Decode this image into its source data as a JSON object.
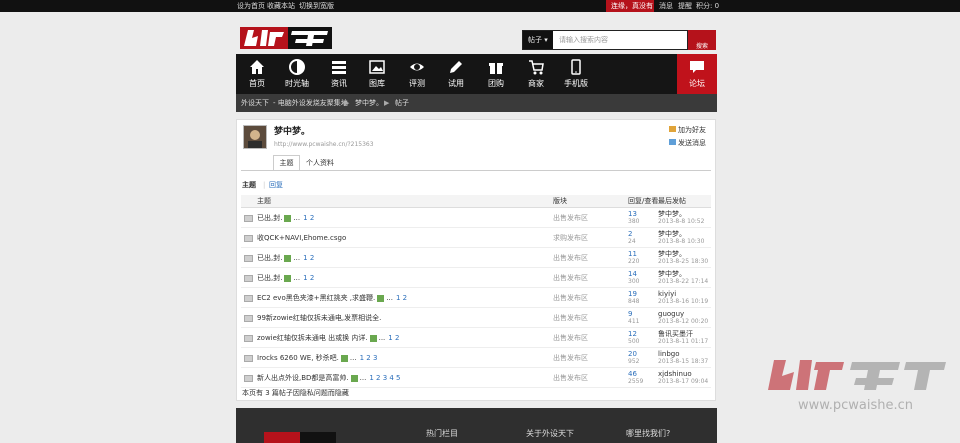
{
  "topbar": {
    "set_home": "设为首页",
    "bookmark": "收藏本站",
    "switch": "切换到宽版",
    "login_prompt": "连缘，真没有",
    "messages": "消息",
    "remind": "提醒",
    "points": "积分: 0"
  },
  "logo": {
    "text": "外设天下"
  },
  "search": {
    "type": "帖子",
    "placeholder": "请输入搜索内容",
    "button": "搜索"
  },
  "nav": {
    "items": [
      {
        "label": "首页",
        "icon": "home-icon"
      },
      {
        "label": "时光轴",
        "icon": "timeline-icon"
      },
      {
        "label": "资讯",
        "icon": "news-icon"
      },
      {
        "label": "图库",
        "icon": "gallery-icon"
      },
      {
        "label": "评测",
        "icon": "eye-icon"
      },
      {
        "label": "试用",
        "icon": "pen-icon"
      },
      {
        "label": "团购",
        "icon": "gift-icon"
      },
      {
        "label": "商家",
        "icon": "cart-icon"
      },
      {
        "label": "手机版",
        "icon": "phone-icon"
      }
    ],
    "forum": "论坛"
  },
  "breadcrumb": {
    "home": "外设天下",
    "board": "- 电脑外设发烧友聚集地",
    "user": "梦中梦。",
    "section": "帖子"
  },
  "profile": {
    "name": "梦中梦。",
    "url": "http://www.pcwaishe.cn/?215363",
    "add_friend": "加为好友",
    "send_message": "发送消息",
    "tabs": [
      "主题",
      "个人资料"
    ]
  },
  "subtabs": {
    "active": "主题",
    "other": "回复"
  },
  "table": {
    "headers": {
      "topic": "主题",
      "section": "版块",
      "stats": "回复/查看",
      "last": "最后发帖"
    },
    "rows": [
      {
        "title": "已出,封.",
        "pages": "1  2",
        "section": "出售发布区",
        "replies": "13",
        "views": "380",
        "author": "梦中梦。",
        "date": "2013-8-8 10:52"
      },
      {
        "title": "收QCK+NAVI,Ehome.csgo",
        "pages": "",
        "section": "求购发布区",
        "replies": "2",
        "views": "24",
        "author": "梦中梦。",
        "date": "2013-8-8 10:30"
      },
      {
        "title": "已出,封.",
        "pages": "1  2",
        "section": "出售发布区",
        "replies": "11",
        "views": "220",
        "author": "梦中梦。",
        "date": "2013-8-25 18:30"
      },
      {
        "title": "已出,封.",
        "pages": "1  2",
        "section": "出售发布区",
        "replies": "14",
        "views": "300",
        "author": "梦中梦。",
        "date": "2013-8-22 17:14"
      },
      {
        "title": "EC2 evo黑色夹漆+黑红挑夹 ,求盛鞭.",
        "pages": "1  2",
        "section": "出售发布区",
        "replies": "19",
        "views": "848",
        "author": "kiyiyi",
        "date": "2013-8-16 10:19"
      },
      {
        "title": "99新zowie红轴仅拆未通电,发票相说全.",
        "pages": "",
        "section": "出售发布区",
        "replies": "9",
        "views": "411",
        "author": "guoguy",
        "date": "2013-8-12 00:20"
      },
      {
        "title": "zowie红轴仅拆未通电  出或换  内详.",
        "pages": "1  2",
        "section": "出售发布区",
        "replies": "12",
        "views": "500",
        "author": "鲁讯买墨汗",
        "date": "2013-8-11 01:17"
      },
      {
        "title": "Irocks 6260 WE, 秒杀吧.",
        "pages": "1  2  3",
        "section": "出售发布区",
        "replies": "20",
        "views": "952",
        "author": "linbgo",
        "date": "2013-8-15 18:37"
      },
      {
        "title": "新人出点外设,BD都是高富帅.",
        "pages": "1  2  3  4  5",
        "section": "出售发布区",
        "replies": "46",
        "views": "2559",
        "author": "xjdshinuo",
        "date": "2013-8-17 09:04"
      }
    ],
    "footer_note": "本页有 3 篇帖子因隐私问题而隐藏"
  },
  "footer": {
    "hot": "热门栏目",
    "about": "关于外设天下",
    "where": "哪里找我们?"
  },
  "watermark": {
    "text": "外设天下",
    "url": "www.pcwaishe.cn"
  },
  "colors": {
    "brand_red": "#b5121b",
    "nav_bg": "#151515",
    "link": "#2a6ebb"
  }
}
